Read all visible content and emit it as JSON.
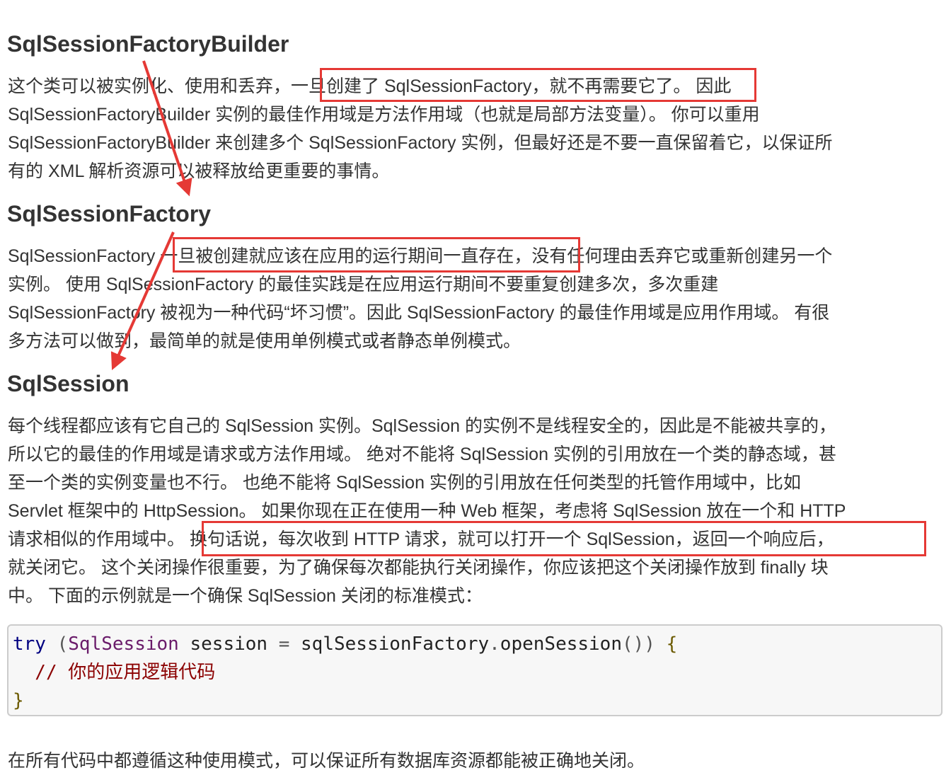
{
  "sections": [
    {
      "heading": "SqlSessionFactoryBuilder",
      "lines": [
        "这个类可以被实例化、使用和丢弃，一旦创建了 SqlSessionFactory，就不再需要它了。 因此",
        "SqlSessionFactoryBuilder 实例的最佳作用域是方法作用域（也就是局部方法变量）。 你可以重用",
        "SqlSessionFactoryBuilder 来创建多个 SqlSessionFactory 实例，但最好还是不要一直保留着它，以保证所",
        "有的 XML 解析资源可以被释放给更重要的事情。"
      ]
    },
    {
      "heading": "SqlSessionFactory",
      "lines": [
        "SqlSessionFactory 一旦被创建就应该在应用的运行期间一直存在，没有任何理由丢弃它或重新创建另一个",
        "实例。 使用 SqlSessionFactory 的最佳实践是在应用运行期间不要重复创建多次，多次重建",
        "SqlSessionFactory 被视为一种代码“坏习惯”。因此 SqlSessionFactory 的最佳作用域是应用作用域。 有很",
        "多方法可以做到，最简单的就是使用单例模式或者静态单例模式。"
      ]
    },
    {
      "heading": "SqlSession",
      "lines": [
        "每个线程都应该有它自己的 SqlSession 实例。SqlSession 的实例不是线程安全的，因此是不能被共享的，",
        "所以它的最佳的作用域是请求或方法作用域。 绝对不能将 SqlSession 实例的引用放在一个类的静态域，甚",
        "至一个类的实例变量也不行。 也绝不能将 SqlSession 实例的引用放在任何类型的托管作用域中，比如",
        "Servlet 框架中的 HttpSession。 如果你现在正在使用一种 Web 框架，考虑将 SqlSession 放在一个和 HTTP",
        "请求相似的作用域中。 换句话说，每次收到 HTTP 请求，就可以打开一个 SqlSession，返回一个响应后，",
        "就关闭它。 这个关闭操作很重要，为了确保每次都能执行关闭操作，你应该把这个关闭操作放到 finally 块",
        "中。 下面的示例就是一个确保 SqlSession 关闭的标准模式："
      ]
    }
  ],
  "code": {
    "line1": {
      "kw": "try",
      "paren_open": " (",
      "cls": "SqlSession",
      "var1": " session",
      "eq": " = ",
      "var2": "sqlSessionFactory",
      "dot": ".",
      "method": "openSession",
      "close": "())",
      "brace": " {"
    },
    "line2": "  // 你的应用逻辑代码",
    "line3": "}"
  },
  "footer": "在所有代码中都遵循这种使用模式，可以保证所有数据库资源都能被正确地关闭。",
  "colors": {
    "highlight_box": "#e53935",
    "arrow": "#e53935",
    "text": "#333333",
    "code_bg": "#f7f7f7"
  }
}
